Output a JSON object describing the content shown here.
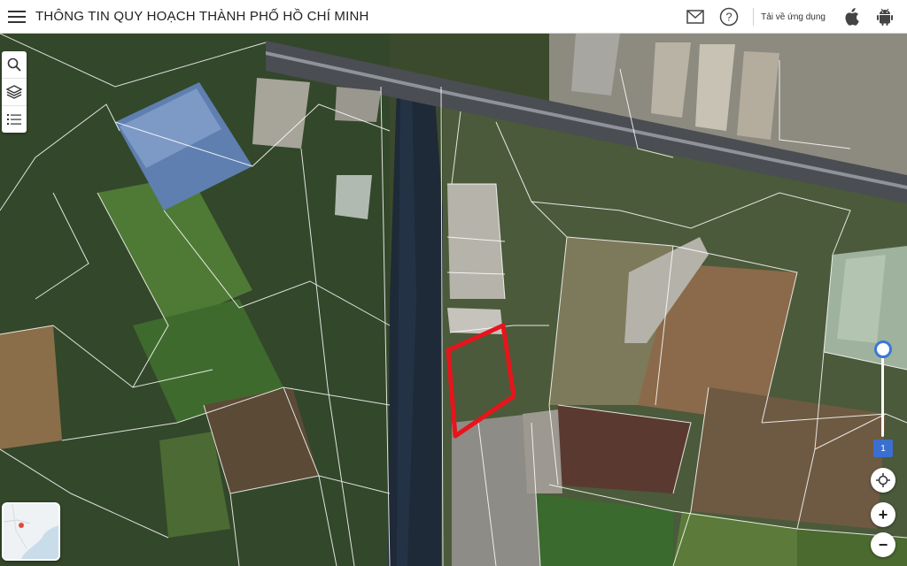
{
  "header": {
    "title": "THÔNG TIN QUY HOẠCH THÀNH PHỐ HỒ CHÍ MINH",
    "download_label": "Tải về ứng dụng"
  },
  "icons": {
    "menu": "hamburger-menu-icon",
    "mail": "mail-icon",
    "help": "question-circle-icon",
    "apple": "apple-icon",
    "android": "android-icon",
    "search": "search-icon",
    "layers": "layers-icon",
    "list": "list-icon",
    "locate": "crosshair-icon",
    "zoom_in": "plus-icon",
    "zoom_out": "minus-icon"
  },
  "map": {
    "zoom_level": "1",
    "zoom_in_label": "+",
    "zoom_out_label": "−",
    "highlight_color": "#e8141c",
    "parcel_line_color": "#ffffff",
    "accent_color": "#3a6fd0"
  }
}
